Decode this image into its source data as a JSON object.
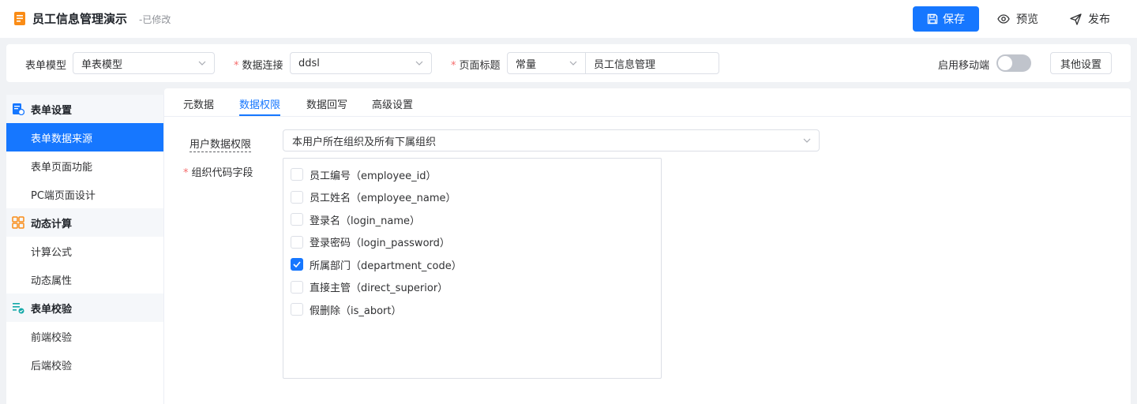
{
  "header": {
    "title": "员工信息管理演示",
    "modified": "-已修改",
    "save_label": "保存",
    "preview_label": "预览",
    "publish_label": "发布"
  },
  "settings": {
    "form_model_label": "表单模型",
    "form_model_value": "单表模型",
    "data_conn_label": "数据连接",
    "data_conn_value": "ddsl",
    "page_title_label": "页面标题",
    "page_title_type": "常量",
    "page_title_value": "员工信息管理",
    "mobile_label": "启用移动端",
    "mobile_enabled": false,
    "other_settings_label": "其他设置"
  },
  "sidebar": {
    "groups": [
      {
        "title": "表单设置",
        "icon": "form-settings-icon",
        "items": [
          "表单数据来源",
          "表单页面功能",
          "PC端页面设计"
        ]
      },
      {
        "title": "动态计算",
        "icon": "calculation-icon",
        "items": [
          "计算公式",
          "动态属性"
        ]
      },
      {
        "title": "表单校验",
        "icon": "validation-icon",
        "items": [
          "前端校验",
          "后端校验"
        ]
      }
    ],
    "active_item": "表单数据来源"
  },
  "tabs": [
    "元数据",
    "数据权限",
    "数据回写",
    "高级设置"
  ],
  "active_tab": "数据权限",
  "form": {
    "user_perm_label": "用户数据权限",
    "user_perm_value": "本用户所在组织及所有下属组织",
    "org_field_label": "组织代码字段",
    "fields": [
      {
        "label": "员工编号（employee_id）",
        "checked": false
      },
      {
        "label": "员工姓名（employee_name）",
        "checked": false
      },
      {
        "label": "登录名（login_name）",
        "checked": false
      },
      {
        "label": "登录密码（login_password）",
        "checked": false
      },
      {
        "label": "所属部门（department_code）",
        "checked": true
      },
      {
        "label": "直接主管（direct_superior）",
        "checked": false
      },
      {
        "label": "假删除（is_abort）",
        "checked": false
      }
    ]
  },
  "colors": {
    "primary": "#1677ff",
    "required": "#f56c6c",
    "border": "#dcdfe6"
  }
}
